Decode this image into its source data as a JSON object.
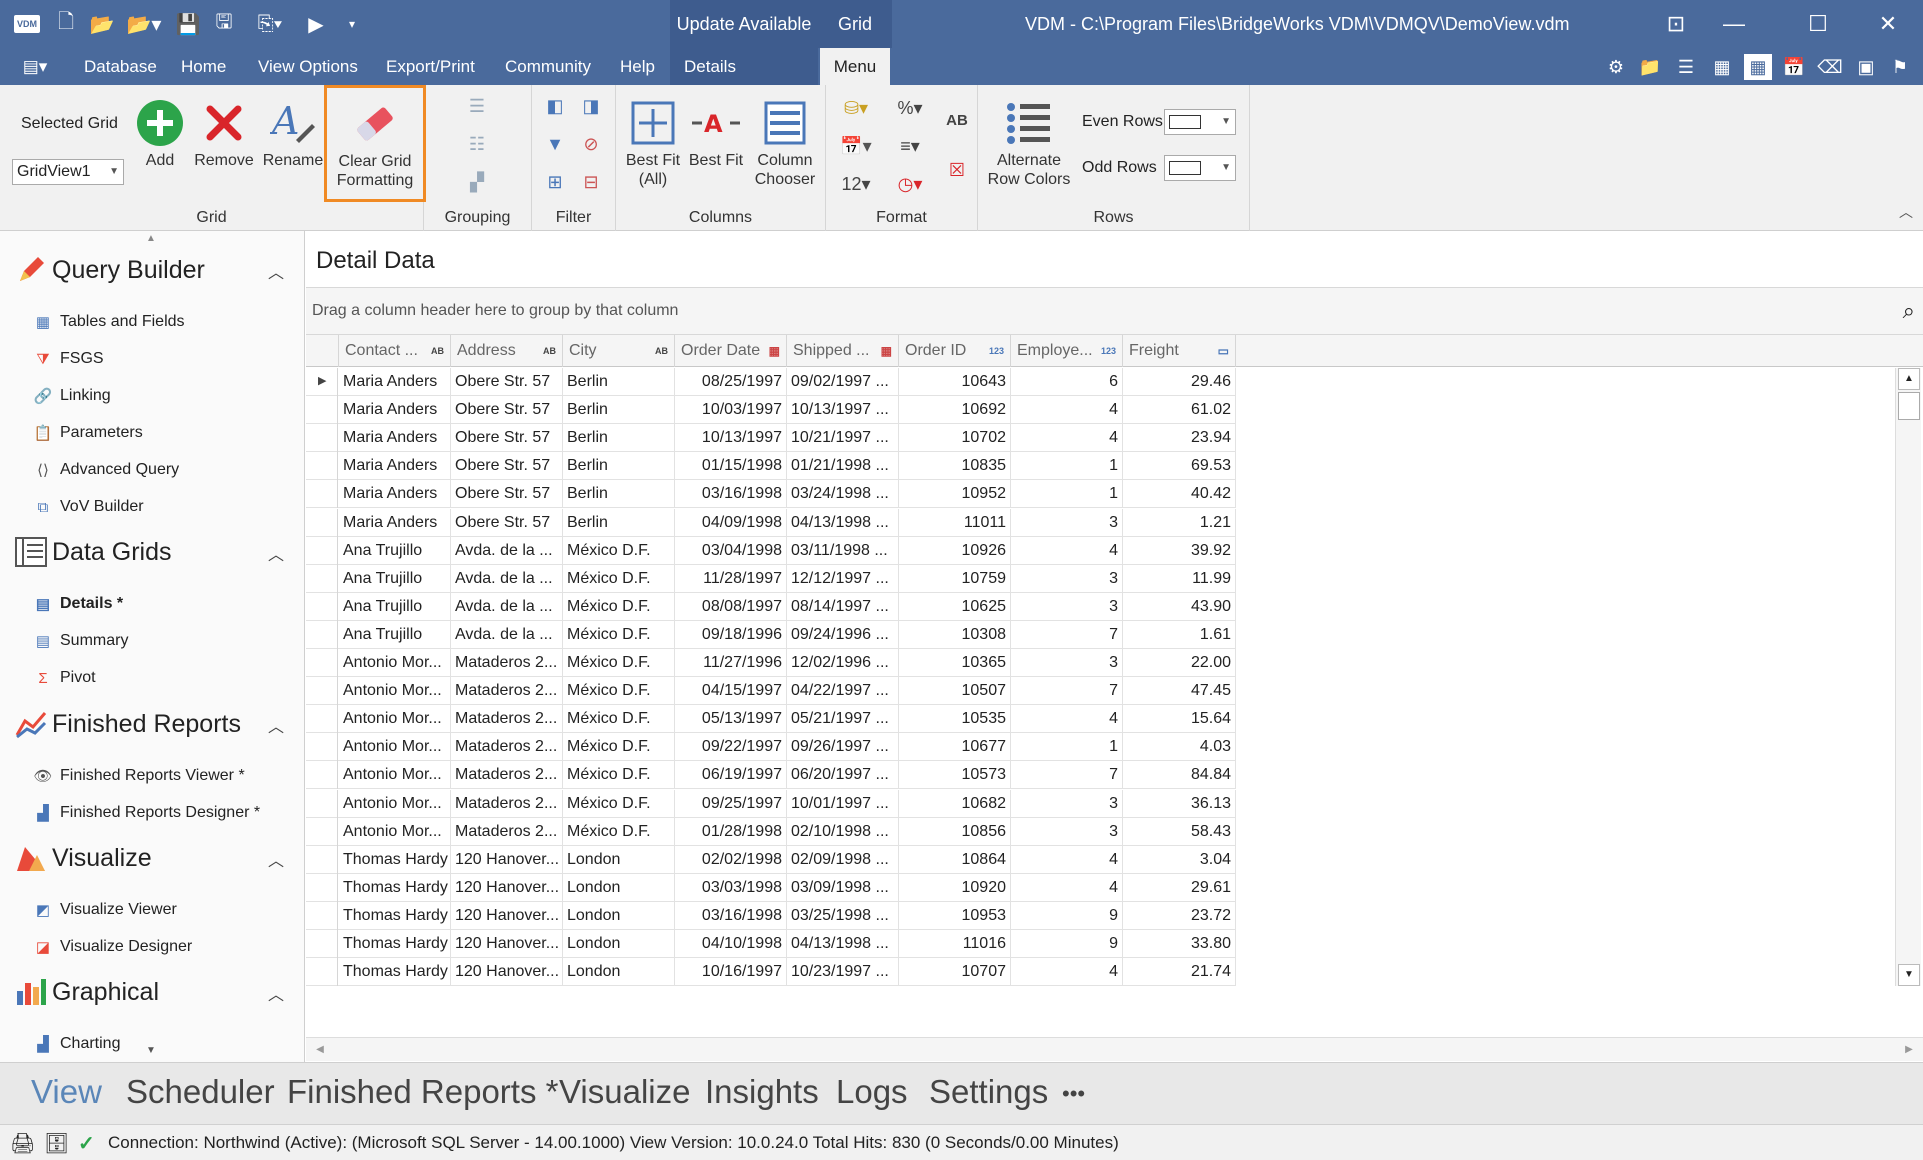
{
  "titlebar": {
    "app_logo": "VDM",
    "update_label": "Update Available",
    "grid_label": "Grid",
    "window_title": "VDM - C:\\Program Files\\BridgeWorks VDM\\VDMQV\\DemoView.vdm"
  },
  "menubar": {
    "items": [
      "Database",
      "Home",
      "View Options",
      "Export/Print",
      "Community",
      "Help"
    ],
    "details_tab": "Details",
    "menu_tab": "Menu"
  },
  "ribbon": {
    "grid_group": {
      "label": "Grid",
      "selected_grid_label": "Selected Grid",
      "selected_grid_value": "GridView1",
      "add": "Add",
      "remove": "Remove",
      "rename": "Rename",
      "clear_line1": "Clear Grid",
      "clear_line2": "Formatting"
    },
    "grouping_label": "Grouping",
    "filter_label": "Filter",
    "columns_group": {
      "label": "Columns",
      "best_fit_all_1": "Best Fit",
      "best_fit_all_2": "(All)",
      "best_fit": "Best Fit",
      "column_chooser_1": "Column",
      "column_chooser_2": "Chooser"
    },
    "format_group": {
      "label": "Format",
      "percent": "%",
      "ab": "AB",
      "twelve": "12"
    },
    "rows_group": {
      "label": "Rows",
      "alt_1": "Alternate",
      "alt_2": "Row Colors",
      "even_rows": "Even Rows",
      "odd_rows": "Odd Rows"
    }
  },
  "nav": {
    "sections": [
      {
        "title": "Query Builder",
        "items": [
          "Tables and Fields",
          "FSGS",
          "Linking",
          "Parameters",
          "Advanced Query",
          "VoV Builder"
        ]
      },
      {
        "title": "Data Grids",
        "items": [
          "Details *",
          "Summary",
          "Pivot"
        ]
      },
      {
        "title": "Finished Reports",
        "items": [
          "Finished Reports Viewer *",
          "Finished Reports Designer *"
        ]
      },
      {
        "title": "Visualize",
        "items": [
          "Visualize Viewer",
          "Visualize Designer"
        ]
      },
      {
        "title": "Graphical",
        "items": [
          "Charting"
        ]
      }
    ]
  },
  "main": {
    "title": "Detail Data",
    "group_hint": "Drag a column header here to group by that column",
    "columns": [
      "Contact ...",
      "Address",
      "City",
      "Order Date",
      "Shipped ...",
      "Order ID",
      "Employe...",
      "Freight"
    ],
    "rows": [
      [
        "Maria Anders",
        "Obere Str. 57",
        "Berlin",
        "08/25/1997",
        "09/02/1997 ...",
        "10643",
        "6",
        "29.46"
      ],
      [
        "Maria Anders",
        "Obere Str. 57",
        "Berlin",
        "10/03/1997",
        "10/13/1997 ...",
        "10692",
        "4",
        "61.02"
      ],
      [
        "Maria Anders",
        "Obere Str. 57",
        "Berlin",
        "10/13/1997",
        "10/21/1997 ...",
        "10702",
        "4",
        "23.94"
      ],
      [
        "Maria Anders",
        "Obere Str. 57",
        "Berlin",
        "01/15/1998",
        "01/21/1998 ...",
        "10835",
        "1",
        "69.53"
      ],
      [
        "Maria Anders",
        "Obere Str. 57",
        "Berlin",
        "03/16/1998",
        "03/24/1998 ...",
        "10952",
        "1",
        "40.42"
      ],
      [
        "Maria Anders",
        "Obere Str. 57",
        "Berlin",
        "04/09/1998",
        "04/13/1998 ...",
        "11011",
        "3",
        "1.21"
      ],
      [
        "Ana Trujillo",
        "Avda. de la ...",
        "México D.F.",
        "03/04/1998",
        "03/11/1998 ...",
        "10926",
        "4",
        "39.92"
      ],
      [
        "Ana Trujillo",
        "Avda. de la ...",
        "México D.F.",
        "11/28/1997",
        "12/12/1997 ...",
        "10759",
        "3",
        "11.99"
      ],
      [
        "Ana Trujillo",
        "Avda. de la ...",
        "México D.F.",
        "08/08/1997",
        "08/14/1997 ...",
        "10625",
        "3",
        "43.90"
      ],
      [
        "Ana Trujillo",
        "Avda. de la ...",
        "México D.F.",
        "09/18/1996",
        "09/24/1996 ...",
        "10308",
        "7",
        "1.61"
      ],
      [
        "Antonio Mor...",
        "Mataderos 2...",
        "México D.F.",
        "11/27/1996",
        "12/02/1996 ...",
        "10365",
        "3",
        "22.00"
      ],
      [
        "Antonio Mor...",
        "Mataderos 2...",
        "México D.F.",
        "04/15/1997",
        "04/22/1997 ...",
        "10507",
        "7",
        "47.45"
      ],
      [
        "Antonio Mor...",
        "Mataderos 2...",
        "México D.F.",
        "05/13/1997",
        "05/21/1997 ...",
        "10535",
        "4",
        "15.64"
      ],
      [
        "Antonio Mor...",
        "Mataderos 2...",
        "México D.F.",
        "09/22/1997",
        "09/26/1997 ...",
        "10677",
        "1",
        "4.03"
      ],
      [
        "Antonio Mor...",
        "Mataderos 2...",
        "México D.F.",
        "06/19/1997",
        "06/20/1997 ...",
        "10573",
        "7",
        "84.84"
      ],
      [
        "Antonio Mor...",
        "Mataderos 2...",
        "México D.F.",
        "09/25/1997",
        "10/01/1997 ...",
        "10682",
        "3",
        "36.13"
      ],
      [
        "Antonio Mor...",
        "Mataderos 2...",
        "México D.F.",
        "01/28/1998",
        "02/10/1998 ...",
        "10856",
        "3",
        "58.43"
      ],
      [
        "Thomas Hardy",
        "120 Hanover...",
        "London",
        "02/02/1998",
        "02/09/1998 ...",
        "10864",
        "4",
        "3.04"
      ],
      [
        "Thomas Hardy",
        "120 Hanover...",
        "London",
        "03/03/1998",
        "03/09/1998 ...",
        "10920",
        "4",
        "29.61"
      ],
      [
        "Thomas Hardy",
        "120 Hanover...",
        "London",
        "03/16/1998",
        "03/25/1998 ...",
        "10953",
        "9",
        "23.72"
      ],
      [
        "Thomas Hardy",
        "120 Hanover...",
        "London",
        "04/10/1998",
        "04/13/1998 ...",
        "11016",
        "9",
        "33.80"
      ],
      [
        "Thomas Hardy",
        "120 Hanover...",
        "London",
        "10/16/1997",
        "10/23/1997 ...",
        "10707",
        "4",
        "21.74"
      ]
    ]
  },
  "bottom_tabs": [
    "View",
    "Scheduler",
    "Finished Reports *",
    "Visualize",
    "Insights",
    "Logs",
    "Settings",
    "•••"
  ],
  "status": {
    "text": "Connection: Northwind (Active): (Microsoft SQL Server - 14.00.1000) View Version: 10.0.24.0   Total Hits: 830 (0 Seconds/0.00 Minutes)"
  },
  "colors": {
    "title_bg": "#4a6a9c",
    "accent": "#5a86b8",
    "highlight_border": "#f08a24",
    "add_green": "#2ca44a",
    "remove_red": "#d9252a"
  }
}
